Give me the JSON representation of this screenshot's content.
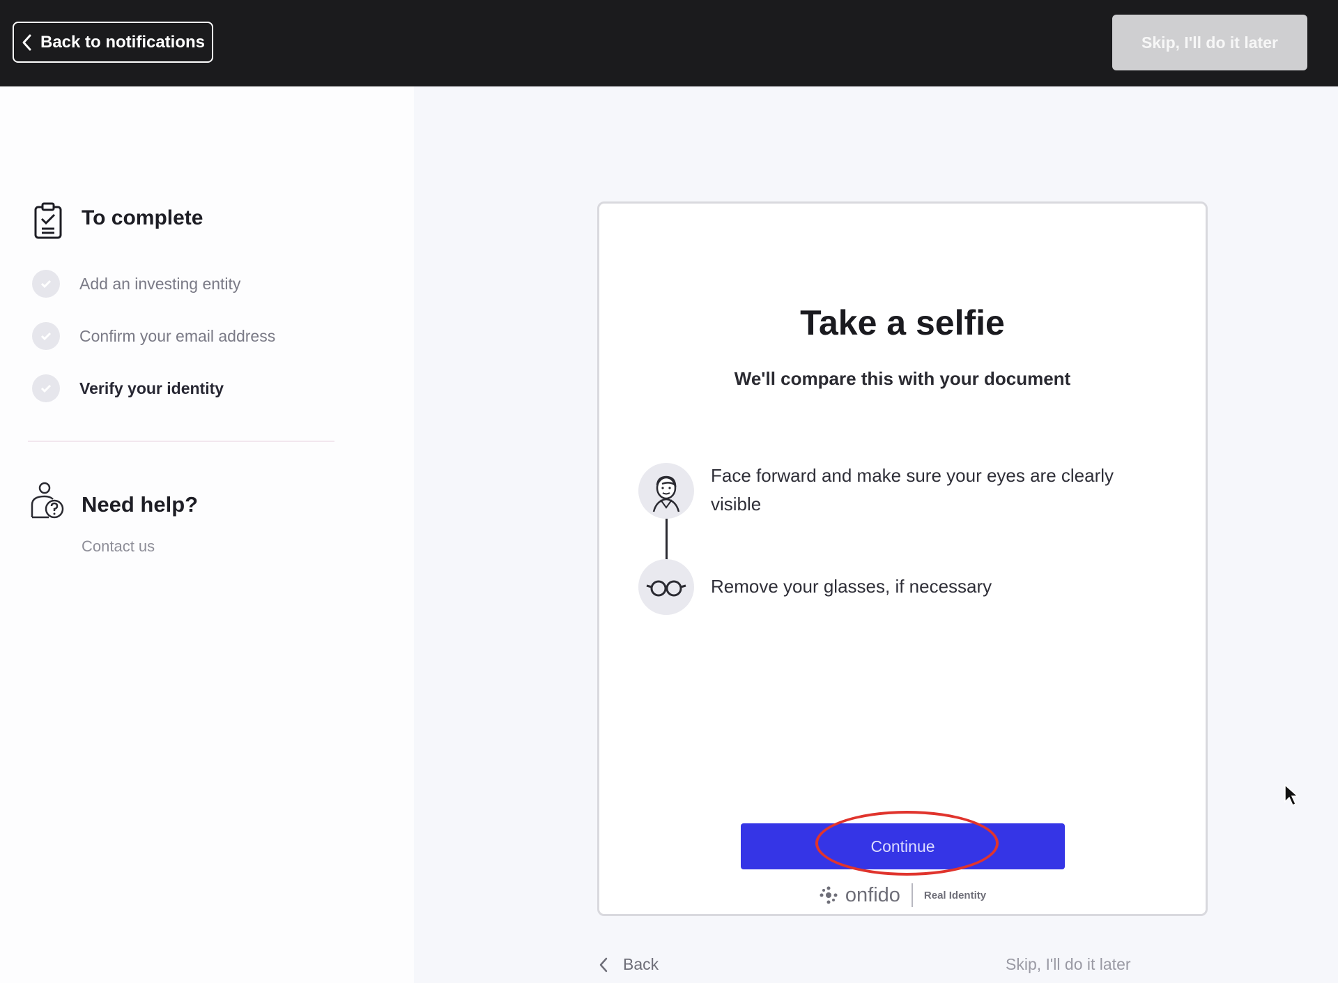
{
  "header": {
    "back_label": "Back to notifications",
    "skip_label": "Skip, I'll do it later"
  },
  "sidebar": {
    "to_complete_title": "To complete",
    "steps": [
      {
        "label": "Add an investing entity",
        "status": "done"
      },
      {
        "label": "Confirm your email address",
        "status": "done"
      },
      {
        "label": "Verify your identity",
        "status": "current"
      }
    ],
    "help_title": "Need help?",
    "contact_label": "Contact us"
  },
  "card": {
    "title": "Take a selfie",
    "subtitle": "We'll compare this with your document",
    "tips": [
      {
        "icon": "face-icon",
        "text": "Face forward and make sure your eyes are clearly visible"
      },
      {
        "icon": "glasses-icon",
        "text": "Remove your glasses, if necessary"
      }
    ],
    "continue_label": "Continue",
    "brand_name": "onfido",
    "brand_tagline": "Real Identity"
  },
  "footer": {
    "back_label": "Back",
    "skip_label": "Skip, I'll do it later"
  },
  "colors": {
    "topbar": "#1b1b1d",
    "primary": "#3535e6",
    "annotation": "#e0342d"
  }
}
